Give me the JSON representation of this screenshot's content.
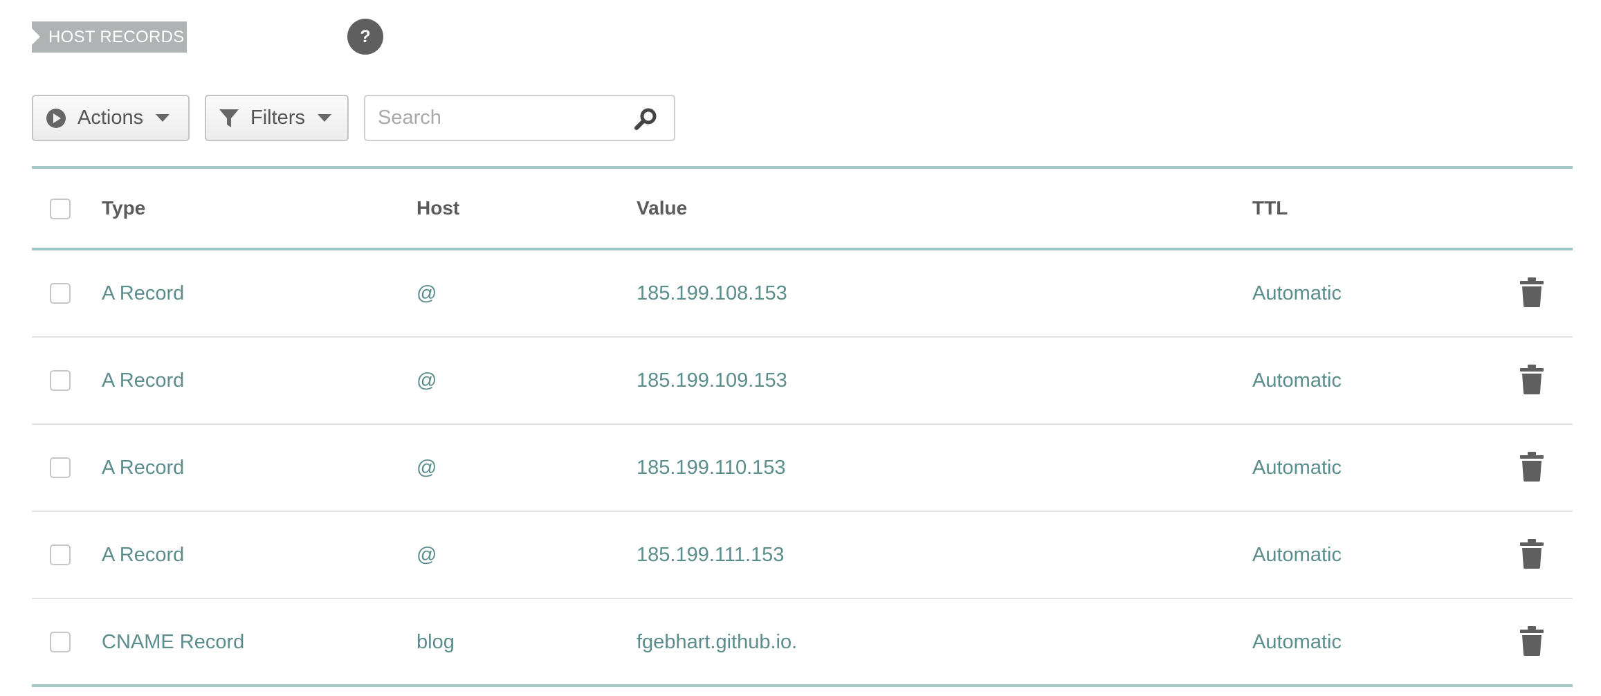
{
  "section": {
    "tag_label": "HOST RECORDS",
    "help_label": "?"
  },
  "toolbar": {
    "actions_label": "Actions",
    "filters_label": "Filters",
    "search_placeholder": "Search",
    "search_value": ""
  },
  "table": {
    "headers": {
      "type": "Type",
      "host": "Host",
      "value": "Value",
      "ttl": "TTL"
    },
    "rows": [
      {
        "type": "A Record",
        "host": "@",
        "value": "185.199.108.153",
        "ttl": "Automatic"
      },
      {
        "type": "A Record",
        "host": "@",
        "value": "185.199.109.153",
        "ttl": "Automatic"
      },
      {
        "type": "A Record",
        "host": "@",
        "value": "185.199.110.153",
        "ttl": "Automatic"
      },
      {
        "type": "A Record",
        "host": "@",
        "value": "185.199.111.153",
        "ttl": "Automatic"
      },
      {
        "type": "CNAME Record",
        "host": "blog",
        "value": "fgebhart.github.io.",
        "ttl": "Automatic"
      }
    ]
  },
  "icons": {
    "actions": "play-circle-icon",
    "filters": "funnel-icon",
    "dropdown": "caret-down-icon",
    "search": "magnifier-icon",
    "delete": "trash-icon"
  },
  "colors": {
    "accent_line": "#9fc8c6",
    "record_text": "#5b8d8c",
    "tag_bg": "#b0b3b3",
    "help_bg": "#5f5f5f"
  }
}
